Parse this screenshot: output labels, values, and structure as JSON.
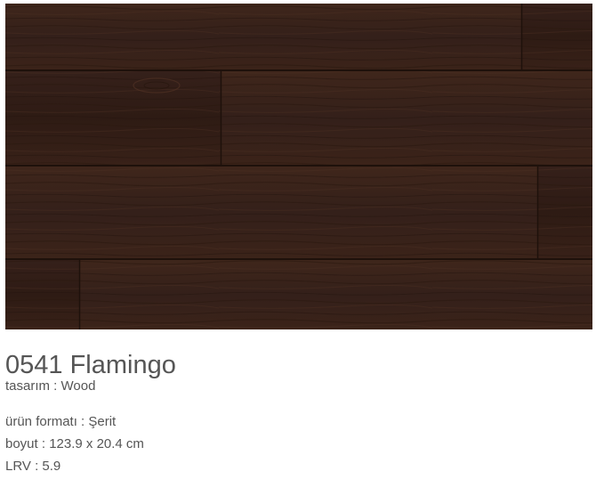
{
  "product": {
    "image_alt": "wood-plank-texture",
    "title": "0541 Flamingo",
    "specs": {
      "design": "tasarım : Wood",
      "format": "ürün formatı : Şerit",
      "size": "boyut : 123.9 x 20.4 cm",
      "lrv": "LRV : 5.9"
    }
  },
  "colors": {
    "wood_base": "#3a2219",
    "wood_dark": "#2a1710",
    "wood_light": "#4a2d21",
    "text": "#555555"
  }
}
